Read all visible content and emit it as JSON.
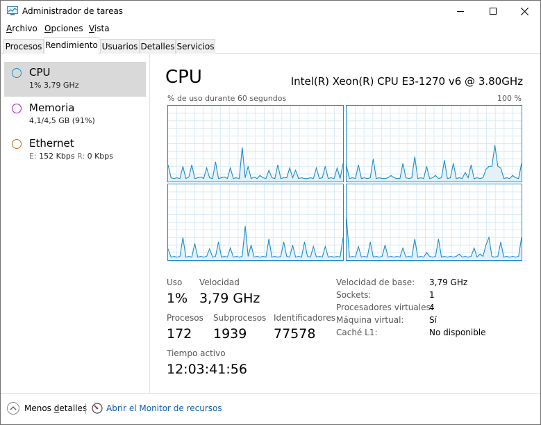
{
  "window": {
    "title": "Administrador de tareas",
    "icon": "task-manager-icon"
  },
  "menu": {
    "items": [
      {
        "label": "Archivo",
        "mnemonic": "A",
        "rest": "rchivo"
      },
      {
        "label": "Opciones",
        "mnemonic": "O",
        "rest": "pciones"
      },
      {
        "label": "Vista",
        "mnemonic": "V",
        "rest": "ista"
      }
    ]
  },
  "tabs": [
    {
      "label": "Procesos",
      "active": false
    },
    {
      "label": "Rendimiento",
      "active": true
    },
    {
      "label": "Usuarios",
      "active": false
    },
    {
      "label": "Detalles",
      "active": false
    },
    {
      "label": "Servicios",
      "active": false
    }
  ],
  "sidebar": {
    "items": [
      {
        "name": "CPU",
        "sub": "1% 3,79 GHz",
        "color": "#1a8ec9",
        "selected": true
      },
      {
        "name": "Memoria",
        "sub": "4,1/4,5 GB (91%)",
        "color": "#9c1fb0",
        "selected": false
      },
      {
        "name": "Ethernet",
        "sub_e_label": "E:",
        "sub_e_value": "152 Kbps",
        "sub_r_label": "R:",
        "sub_r_value": "0 Kbps",
        "color": "#b36b1a",
        "selected": false
      }
    ]
  },
  "main": {
    "title": "CPU",
    "model": "Intel(R) Xeon(R) CPU E3-1270 v6 @ 3.80GHz",
    "graph_label": "% de uso durante 60 segundos",
    "graph_max": "100 %",
    "stats": {
      "uso_label": "Uso",
      "uso_value": "1%",
      "velocidad_label": "Velocidad",
      "velocidad_value": "3,79 GHz",
      "procesos_label": "Procesos",
      "procesos_value": "172",
      "subprocesos_label": "Subprocesos",
      "subprocesos_value": "1939",
      "identificadores_label": "Identificadores",
      "identificadores_value": "77578",
      "tiempo_label": "Tiempo activo",
      "tiempo_value": "12:03:41:56"
    },
    "specs": [
      {
        "label": "Velocidad de base:",
        "value": "3,79 GHz"
      },
      {
        "label": "Sockets:",
        "value": "1"
      },
      {
        "label": "Procesadores virtuales:",
        "value": "4"
      },
      {
        "label": "Máquina virtual:",
        "value": "Sí"
      },
      {
        "label": "Caché L1:",
        "value": "No disponible"
      }
    ]
  },
  "graphs": {
    "line_color": "#1a8ec9",
    "fill_color": "#e5f1f9",
    "grid_color": "#d9eaf4",
    "cores": [
      [
        0.22,
        0.05,
        0.04,
        0.05,
        0.04,
        0.2,
        0.04,
        0.06,
        0.22,
        0.04,
        0.05,
        0.06,
        0.04,
        0.18,
        0.05,
        0.04,
        0.26,
        0.04,
        0.05,
        0.06,
        0.04,
        0.18,
        0.04,
        0.05,
        0.04,
        0.45,
        0.05,
        0.2,
        0.04,
        0.06,
        0.04,
        0.08,
        0.05,
        0.04,
        0.15,
        0.05,
        0.04,
        0.22,
        0.04,
        0.05,
        0.05,
        0.18,
        0.05,
        0.15,
        0.04,
        0.05,
        0.04,
        0.04,
        0.05,
        0.04,
        0.18,
        0.04,
        0.05,
        0.2,
        0.04,
        0.05,
        0.04,
        0.18,
        0.04,
        0.24
      ],
      [
        0.2,
        0.04,
        0.05,
        0.04,
        0.22,
        0.04,
        0.05,
        0.04,
        0.05,
        0.3,
        0.04,
        0.05,
        0.04,
        0.04,
        0.05,
        0.08,
        0.05,
        0.04,
        0.04,
        0.24,
        0.05,
        0.04,
        0.05,
        0.33,
        0.04,
        0.05,
        0.04,
        0.2,
        0.04,
        0.05,
        0.08,
        0.04,
        0.05,
        0.28,
        0.04,
        0.05,
        0.24,
        0.04,
        0.05,
        0.04,
        0.12,
        0.05,
        0.22,
        0.04,
        0.05,
        0.04,
        0.05,
        0.16,
        0.2,
        0.2,
        0.48,
        0.2,
        0.18,
        0.04,
        0.05,
        0.04,
        0.08,
        0.05,
        0.04,
        0.24
      ],
      [
        0.15,
        0.04,
        0.05,
        0.04,
        0.05,
        0.3,
        0.04,
        0.05,
        0.04,
        0.22,
        0.04,
        0.05,
        0.04,
        0.05,
        0.15,
        0.04,
        0.05,
        0.24,
        0.04,
        0.05,
        0.04,
        0.16,
        0.04,
        0.05,
        0.04,
        0.05,
        0.45,
        0.05,
        0.2,
        0.04,
        0.05,
        0.04,
        0.05,
        0.04,
        0.28,
        0.04,
        0.05,
        0.04,
        0.05,
        0.24,
        0.05,
        0.04,
        0.2,
        0.04,
        0.05,
        0.04,
        0.24,
        0.05,
        0.04,
        0.18,
        0.04,
        0.05,
        0.04,
        0.18,
        0.04,
        0.05,
        0.04,
        0.05,
        0.04,
        0.3
      ],
      [
        0.55,
        0.04,
        0.05,
        0.04,
        0.18,
        0.04,
        0.05,
        0.04,
        0.24,
        0.04,
        0.05,
        0.04,
        0.05,
        0.2,
        0.04,
        0.05,
        0.04,
        0.05,
        0.04,
        0.16,
        0.04,
        0.05,
        0.04,
        0.28,
        0.04,
        0.05,
        0.04,
        0.1,
        0.05,
        0.04,
        0.05,
        0.28,
        0.04,
        0.05,
        0.04,
        0.05,
        0.04,
        0.05,
        0.08,
        0.04,
        0.05,
        0.04,
        0.05,
        0.16,
        0.04,
        0.08,
        0.05,
        0.2,
        0.3,
        0.05,
        0.04,
        0.05,
        0.24,
        0.04,
        0.05,
        0.04,
        0.05,
        0.04,
        0.05,
        0.3
      ]
    ]
  },
  "bottom": {
    "less_mnemonic": "Menos ",
    "less_underlined": "d",
    "less_rest": "etalles",
    "monitor_link": "Abrir el Monitor de recursos"
  }
}
